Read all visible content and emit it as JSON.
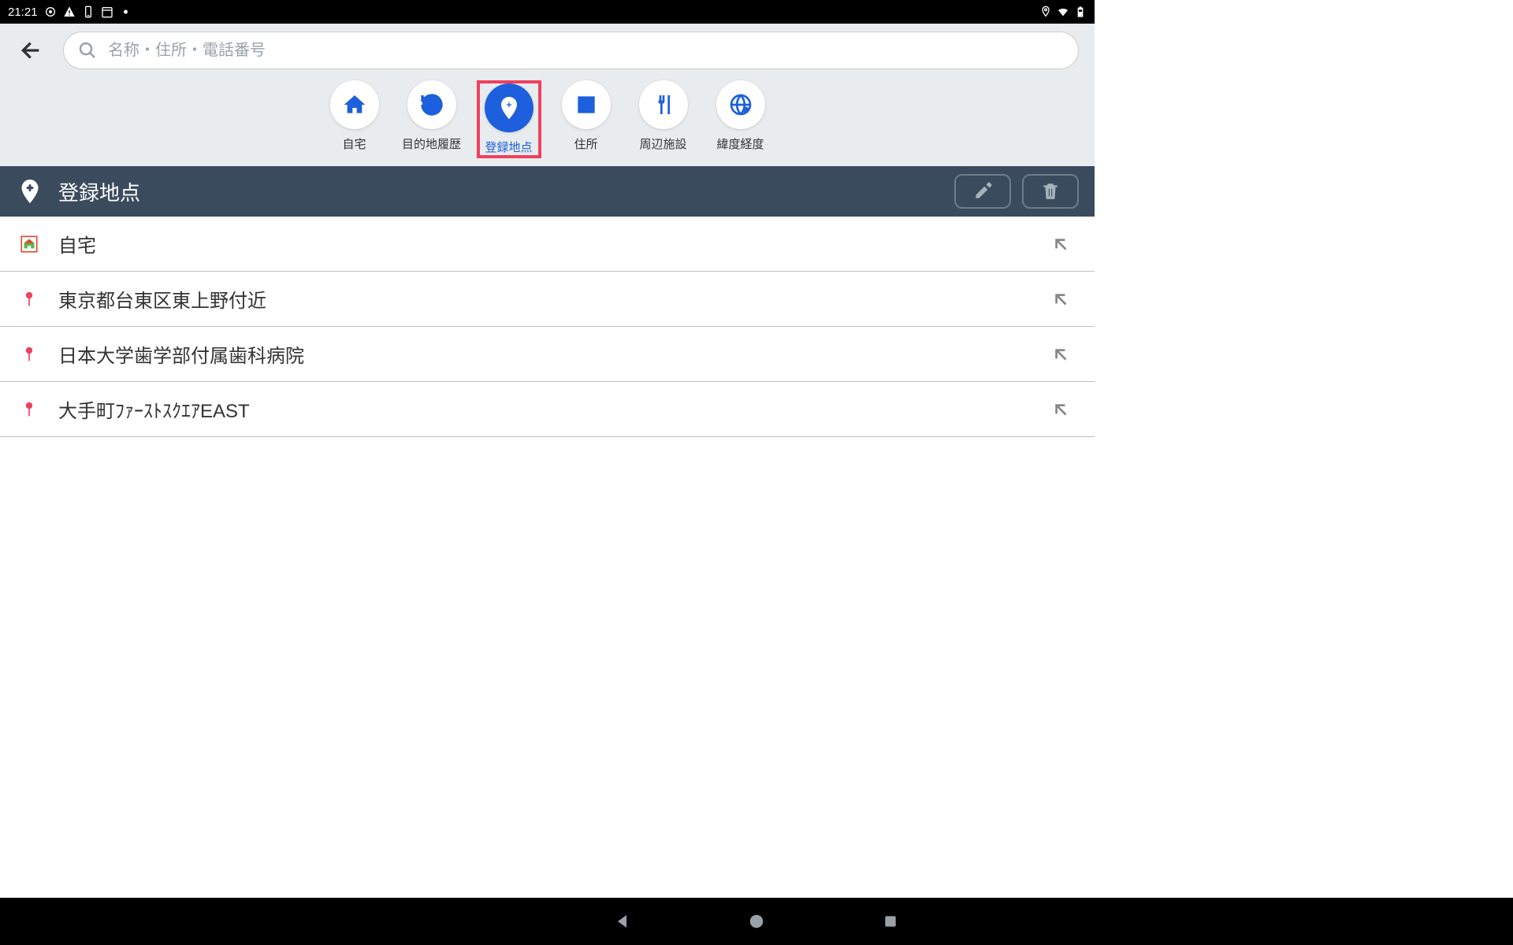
{
  "status": {
    "time": "21:21"
  },
  "search": {
    "placeholder": "名称・住所・電話番号"
  },
  "categories": [
    {
      "key": "home",
      "label": "自宅"
    },
    {
      "key": "history",
      "label": "目的地履歴"
    },
    {
      "key": "saved",
      "label": "登録地点",
      "selected": true
    },
    {
      "key": "address",
      "label": "住所"
    },
    {
      "key": "nearby",
      "label": "周辺施設"
    },
    {
      "key": "latlng",
      "label": "緯度経度"
    }
  ],
  "section": {
    "title": "登録地点"
  },
  "rows": [
    {
      "icon": "home",
      "text": "自宅"
    },
    {
      "icon": "pin",
      "text": "東京都台東区東上野付近"
    },
    {
      "icon": "pin",
      "text": "日本大学歯学部付属歯科病院"
    },
    {
      "icon": "pin",
      "text": "大手町ﾌｧｰｽﾄｽｸｴｱEAST"
    }
  ]
}
